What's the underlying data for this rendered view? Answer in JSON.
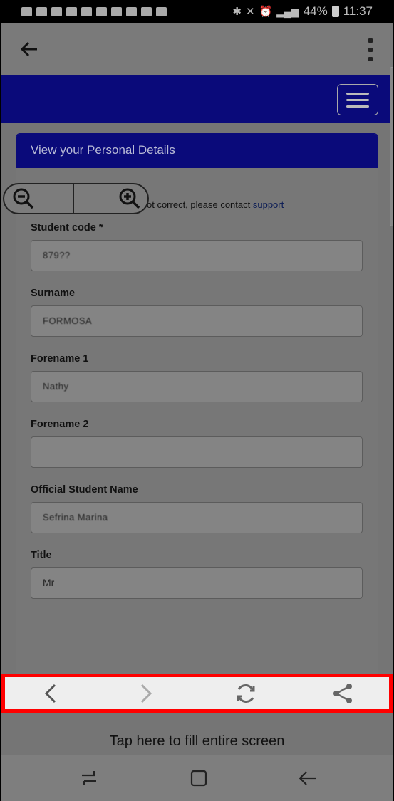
{
  "status": {
    "battery": "44%",
    "time": "11:37"
  },
  "panel": {
    "heading": "View your Personal Details",
    "notice_text": "ot correct, please contact ",
    "notice_link": "support"
  },
  "fields": [
    {
      "label": "Student code *",
      "value": "879??"
    },
    {
      "label": "Surname",
      "value": "FORMOSA"
    },
    {
      "label": "Forename 1",
      "value": "Nathy"
    },
    {
      "label": "Forename 2",
      "value": ""
    },
    {
      "label": "Official Student Name",
      "value": "Sefrina Marina"
    },
    {
      "label": "Title",
      "value": "Mr"
    }
  ],
  "footer": {
    "fill_screen_text": "Tap here to fill entire screen"
  },
  "colors": {
    "header_blue": "#0a0a7a",
    "highlight": "#ff0000"
  }
}
